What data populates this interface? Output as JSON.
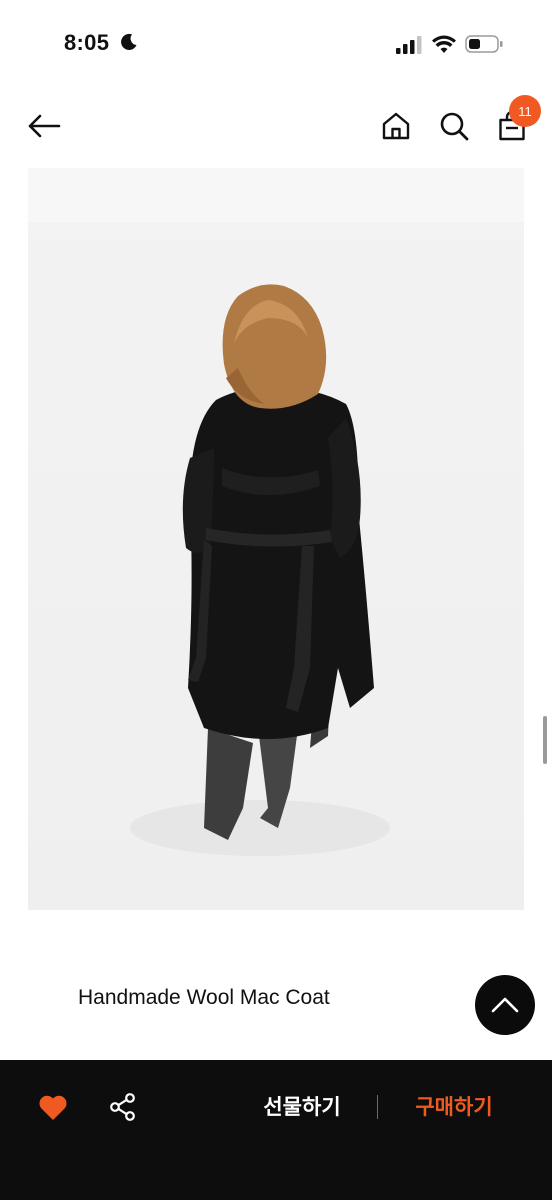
{
  "status_bar": {
    "time": "8:05",
    "icons": [
      "moon-icon",
      "signal-icon",
      "wifi-icon",
      "battery-icon"
    ]
  },
  "nav": {
    "icons": [
      "back-arrow-icon",
      "home-icon",
      "search-icon",
      "shopping-bag-icon"
    ],
    "cart_count": "11"
  },
  "product": {
    "title": "Handmade Wool Mac Coat"
  },
  "bottom_bar": {
    "gift_label": "선물하기",
    "buy_label": "구매하기",
    "icons": [
      "heart-icon",
      "share-icon"
    ]
  },
  "colors": {
    "accent": "#f05a22",
    "bar_background": "#0d0d0d"
  }
}
